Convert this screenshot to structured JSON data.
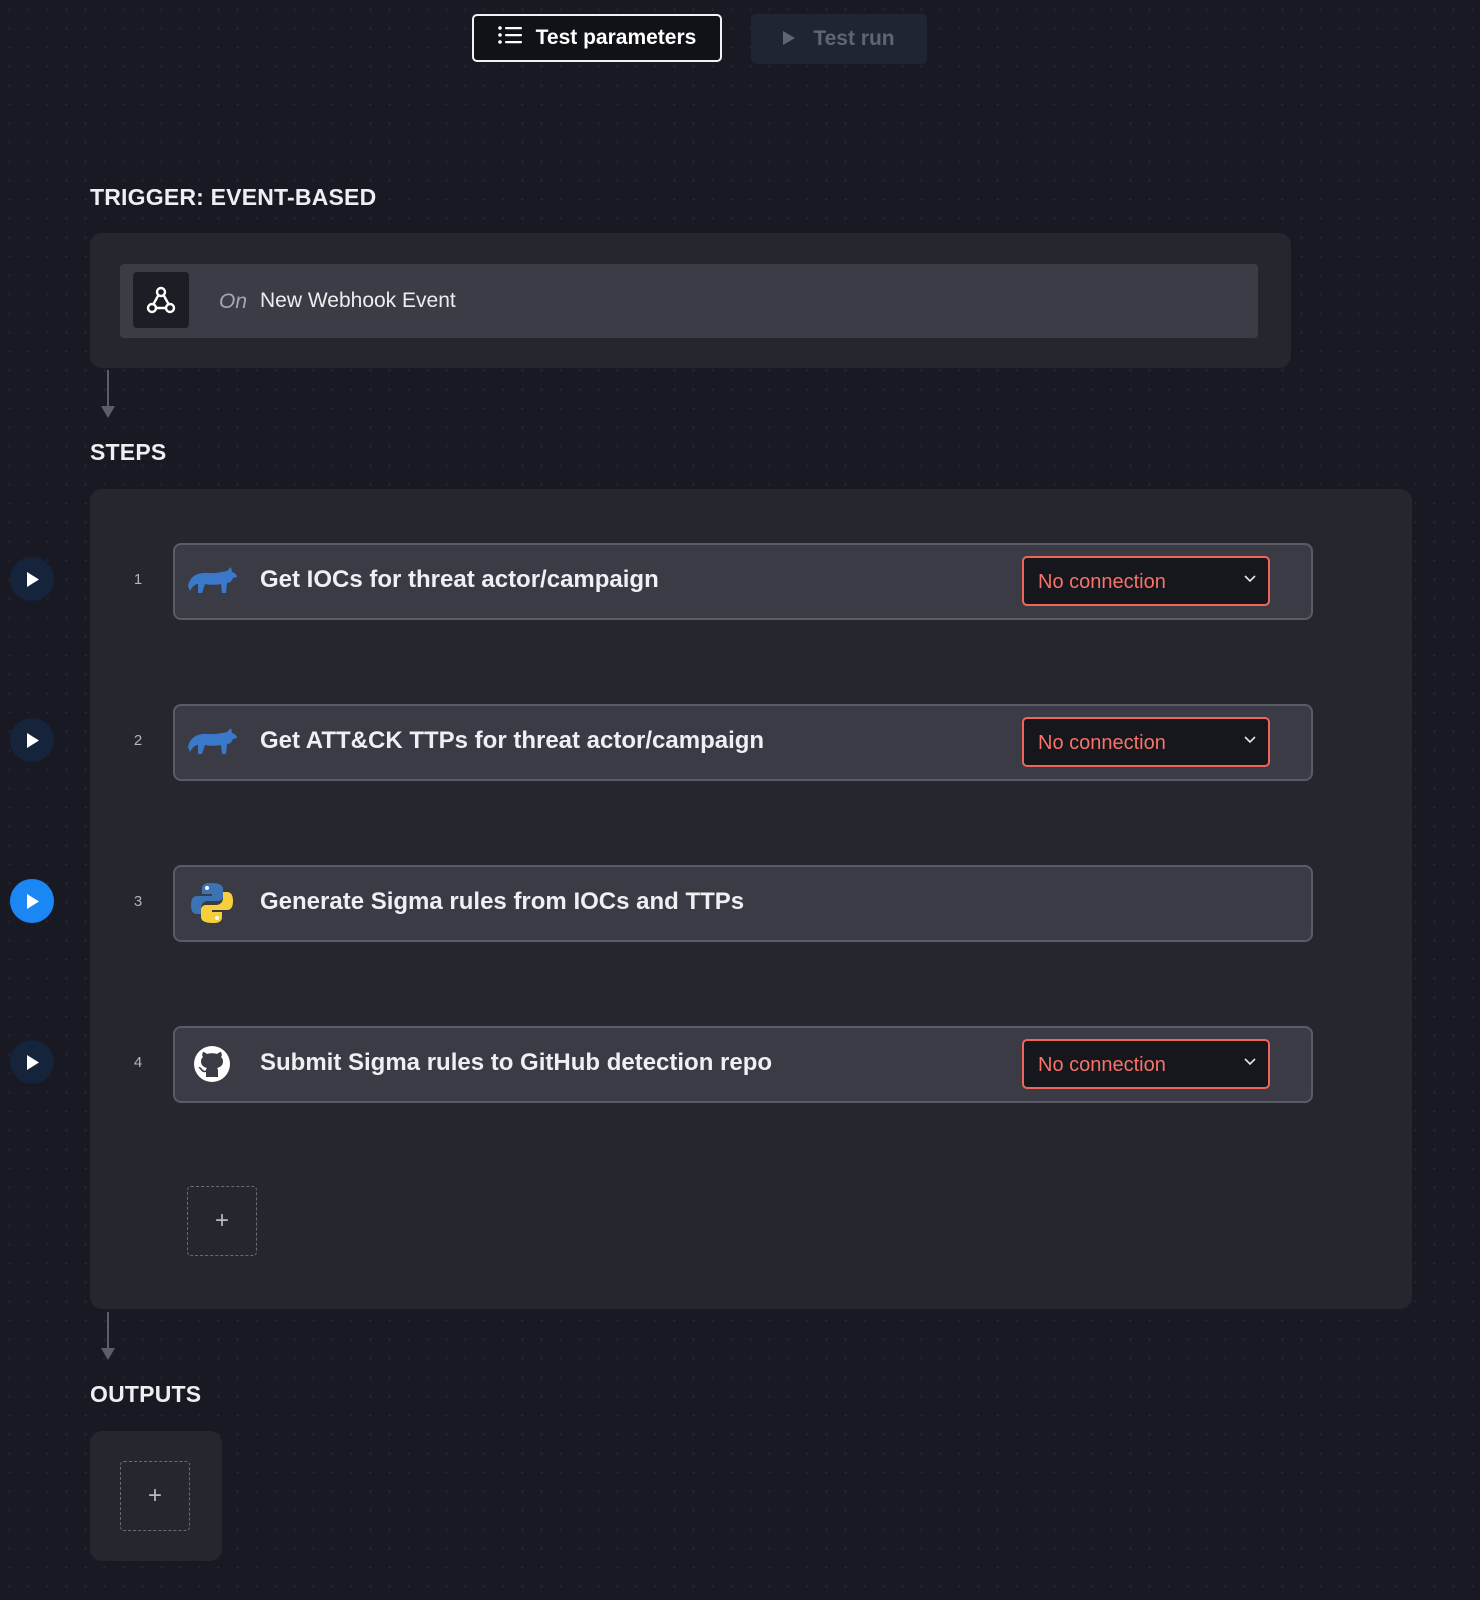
{
  "toolbar": {
    "test_parameters_label": "Test parameters",
    "test_run_label": "Test run"
  },
  "trigger": {
    "section_title": "TRIGGER: EVENT-BASED",
    "on_label": "On",
    "event_label": "New Webhook Event",
    "icon": "webhook-icon"
  },
  "steps": {
    "section_title": "STEPS",
    "items": [
      {
        "number": "1",
        "title": "Get IOCs for threat actor/campaign",
        "icon": "rhino-icon",
        "connection": "No connection"
      },
      {
        "number": "2",
        "title": "Get ATT&CK TTPs for threat actor/campaign",
        "icon": "rhino-icon",
        "connection": "No connection"
      },
      {
        "number": "3",
        "title": "Generate Sigma rules from IOCs and TTPs",
        "icon": "python-icon",
        "connection": ""
      },
      {
        "number": "4",
        "title": "Submit Sigma rules to GitHub detection repo",
        "icon": "github-icon",
        "connection": "No connection"
      }
    ],
    "add_label": "+"
  },
  "outputs": {
    "section_title": "OUTPUTS",
    "add_label": "+"
  },
  "colors": {
    "background": "#181922",
    "panel": "#25262e",
    "card": "#3a3b44",
    "accent_blue": "#1b87f5",
    "error_red": "#f0645a"
  }
}
